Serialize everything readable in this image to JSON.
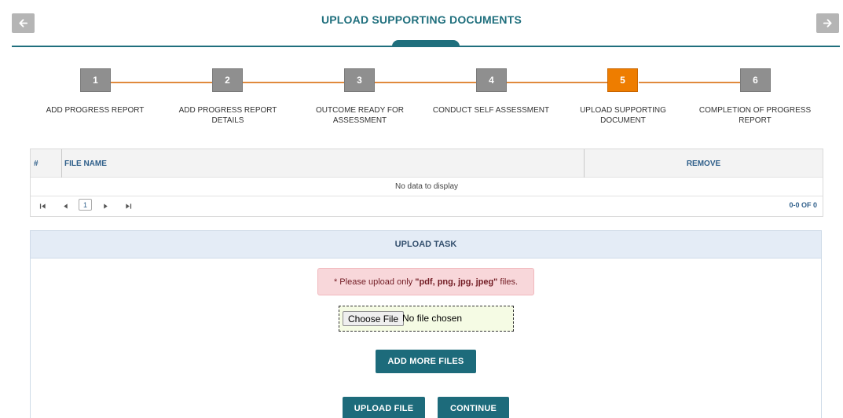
{
  "header": {
    "title": "UPLOAD SUPPORTING DOCUMENTS",
    "prev_icon": "arrow-left-icon",
    "next_icon": "arrow-right-icon"
  },
  "stepper": {
    "steps": [
      {
        "number": "1",
        "label": "ADD PROGRESS REPORT",
        "active": false
      },
      {
        "number": "2",
        "label": "ADD PROGRESS REPORT DETAILS",
        "active": false
      },
      {
        "number": "3",
        "label": "OUTCOME READY FOR ASSESSMENT",
        "active": false
      },
      {
        "number": "4",
        "label": "CONDUCT SELF ASSESSMENT",
        "active": false
      },
      {
        "number": "5",
        "label": "UPLOAD SUPPORTING DOCUMENT",
        "active": true
      },
      {
        "number": "6",
        "label": "COMPLETION OF PROGRESS REPORT",
        "active": false
      }
    ],
    "colors": {
      "inactive": "#8f8f8f",
      "active": "#ee7d00",
      "line": "#e08a3c"
    }
  },
  "grid": {
    "columns": [
      "#",
      "FILE NAME",
      "REMOVE"
    ],
    "empty_message": "No data to display",
    "pager": {
      "current_page": "1",
      "info": "0-0 OF 0"
    }
  },
  "upload_panel": {
    "title": "UPLOAD TASK",
    "alert": {
      "prefix": "* Please upload only",
      "types": "\"pdf, png, jpg, jpeg\"",
      "suffix": "files."
    },
    "file_input": {
      "button_label": "Choose File",
      "status": "No file chosen"
    },
    "add_more_label": "ADD MORE FILES",
    "upload_label": "UPLOAD FILE",
    "continue_label": "CONTINUE"
  },
  "colors": {
    "accent": "#1f6f7d",
    "button": "#1d6b7b"
  }
}
